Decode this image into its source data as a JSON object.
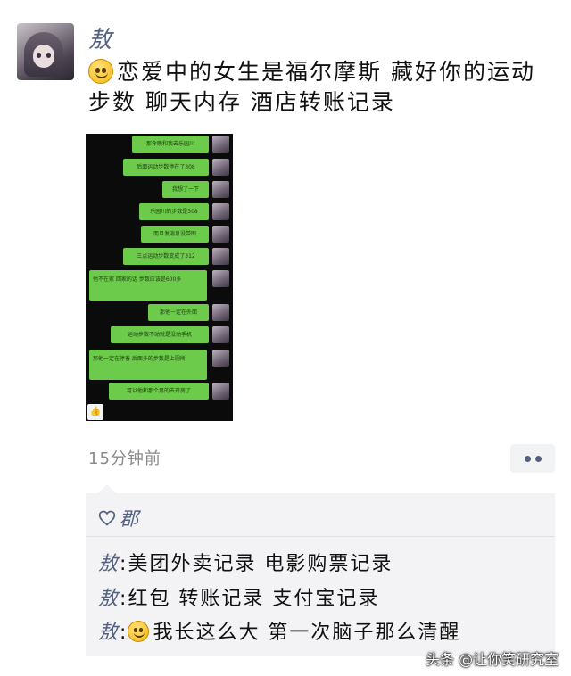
{
  "post": {
    "username": "敖",
    "text": "恋爱中的女生是福尔摩斯 藏好你的运动步数 聊天内存 酒店转账记录",
    "time": "15分钟前",
    "emoji": "smile-emoji"
  },
  "screenshot": {
    "messages": [
      "那今晚和我去乐园川",
      "后面运动步数停在了308",
      "我想了一下",
      "乐园川的步数是308",
      "而且发消息没带图",
      "三点运动步数变成了312",
      "他不在家 回家的话 步数应该是600多",
      "那他一定在外面",
      "运动步数不动就是没动手机",
      "那他一定在停着 后面多的步数是上厕所",
      "可以他和那个男的去开房了"
    ]
  },
  "likes": {
    "name": "郡"
  },
  "comments": [
    {
      "author": "敖",
      "sep": ":",
      "text": "美团外卖记录 电影购票记录"
    },
    {
      "author": "敖",
      "sep": ":",
      "text": "红包 转账记录 支付宝记录"
    },
    {
      "author": "敖",
      "sep": ":",
      "text": "我长这么大 第一次脑子那么清醒"
    }
  ],
  "watermark": "头条 @让你笑研究室",
  "colors": {
    "name": "#54617f",
    "bubble_green": "#6ccb4a",
    "comment_bg": "#f3f3f5"
  }
}
